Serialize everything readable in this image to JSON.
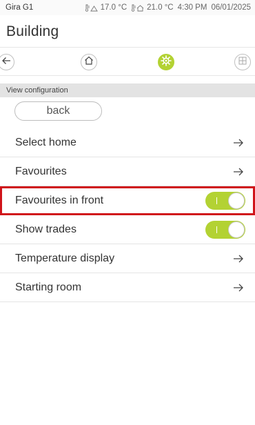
{
  "status_bar": {
    "device": "Gira G1",
    "outdoor_temp": "17.0 °C",
    "indoor_temp": "21.0 °C",
    "time": "4:30 PM",
    "date": "06/01/2025"
  },
  "header": {
    "title": "Building"
  },
  "nav": {
    "items": [
      {
        "icon": "arrow-left-icon",
        "active": false
      },
      {
        "icon": "home-icon",
        "active": false
      },
      {
        "icon": "settings-gear-icon",
        "active": true
      },
      {
        "icon": "grid-icon",
        "active": false
      }
    ],
    "accent_color": "#b3d233"
  },
  "section": {
    "title": "View configuration",
    "back_label": "back"
  },
  "rows": [
    {
      "label": "Select home",
      "control": "arrow"
    },
    {
      "label": "Favourites",
      "control": "arrow"
    },
    {
      "label": "Favourites in front",
      "control": "toggle",
      "on": true,
      "highlighted": true
    },
    {
      "label": "Show trades",
      "control": "toggle",
      "on": true
    },
    {
      "label": "Temperature display",
      "control": "arrow"
    },
    {
      "label": "Starting room",
      "control": "arrow"
    }
  ],
  "highlight_color": "#d0141a"
}
